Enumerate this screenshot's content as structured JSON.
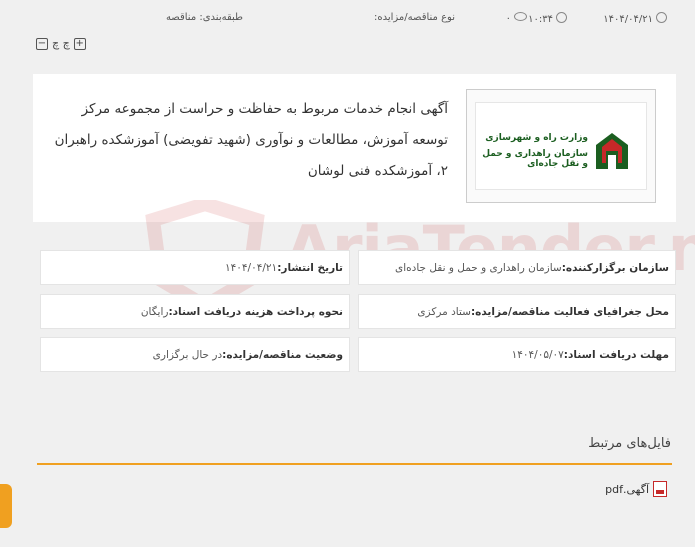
{
  "meta": {
    "date": "۱۴۰۴/۰۴/۲۱",
    "time": "۱۰:۳۴",
    "views": "۰",
    "type_label": "نوع مناقصه/مزایده:",
    "category_label": "طبقه‌بندی: مناقصه"
  },
  "tools": {
    "print": "چ چ",
    "zoom_out": "−",
    "zoom_in": "+"
  },
  "logo": {
    "line1": "وزارت راه و شهرسازی",
    "line2": "سازمان راهداری و حمل و نقل جاده‌ای"
  },
  "title": "آگهی انجام خدمات مربوط به حفاظت و حراست از مجموعه مرکز توسعه آموزش، مطالعات و نوآوری (شهید تفویضی) آموزشکده راهبران ۲، آموزشکده فنی لوشان",
  "watermark": "AriaTender.ne",
  "details": {
    "org_label": "سازمان برگزارکننده:",
    "org_value": "سازمان راهداری و حمل و نقل جاده‌ای",
    "pub_label": "تاریخ انتشار:",
    "pub_value": "۱۴۰۴/۰۴/۲۱",
    "geo_label": "محل جغرافیای فعالیت مناقصه/مزایده:",
    "geo_value": "ستاد مرکزی",
    "fee_label": "نحوه پرداخت هزینه دریافت اسناد:",
    "fee_value": "رایگان",
    "deadline_label": "مهلت دریافت اسناد:",
    "deadline_value": "۱۴۰۴/۰۵/۰۷",
    "status_label": "وضعیت مناقصه/مزایده:",
    "status_value": "در حال برگزاری"
  },
  "files": {
    "title": "فایل‌های مرتبط",
    "items": [
      "آگهی.pdf"
    ]
  },
  "colors": {
    "accent": "#f0a020",
    "brand_green": "#1b5e20",
    "brand_red": "#c62828"
  }
}
